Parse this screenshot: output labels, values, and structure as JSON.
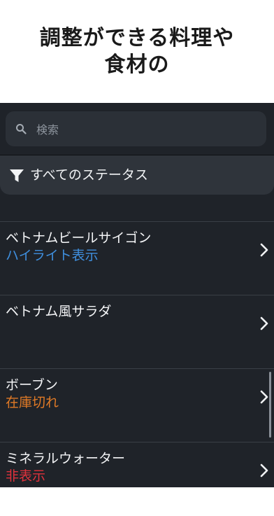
{
  "headline": {
    "line1": "調整ができる料理や",
    "line2": "食材の"
  },
  "search": {
    "placeholder": "検索",
    "value": ""
  },
  "filter": {
    "label": "すべてのステータス"
  },
  "items": [
    {
      "title": "ベトナムビールサイゴン",
      "status": "ハイライト表示",
      "status_color": "#3f8fde"
    },
    {
      "title": "ベトナム風サラダ",
      "status": "",
      "status_color": ""
    },
    {
      "title": "ボーブン",
      "status": "在庫切れ",
      "status_color": "#e07a26"
    },
    {
      "title": "ミネラルウォーター",
      "status": "非表示",
      "status_color": "#e0323c"
    }
  ],
  "colors": {
    "background": "#1f2329",
    "surface": "#2f343b",
    "highlight": "#3f8fde",
    "out_of_stock": "#e07a26",
    "hidden": "#e0323c"
  },
  "icons": [
    "search-icon",
    "filter-icon",
    "chevron-right-icon"
  ]
}
